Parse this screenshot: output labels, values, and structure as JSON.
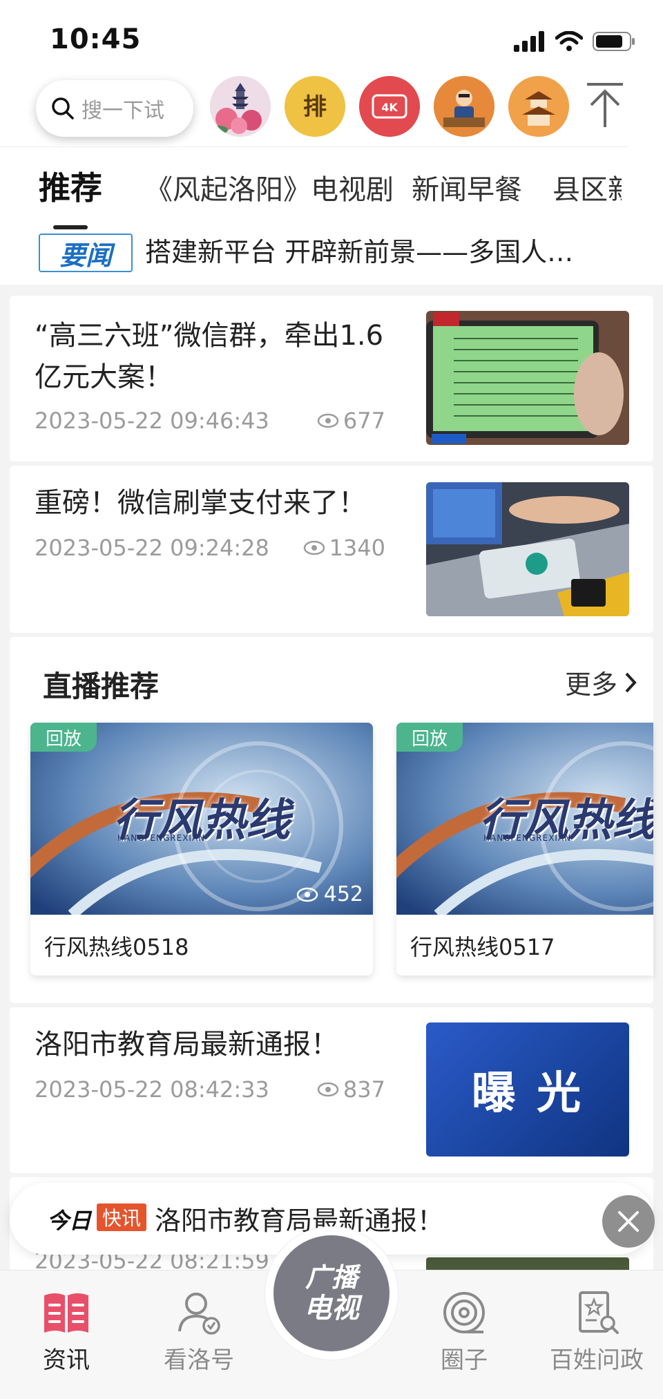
{
  "status": {
    "time": "10:45"
  },
  "search": {
    "placeholder": "搜一下试"
  },
  "shortcuts": [
    {
      "name": "pagoda-peony-icon"
    },
    {
      "name": "paihao-icon"
    },
    {
      "name": "4k-icon"
    },
    {
      "name": "teacher-icon"
    },
    {
      "name": "temple-icon"
    }
  ],
  "tabs": [
    {
      "label": "推荐",
      "active": true
    },
    {
      "label": "《风起洛阳》电视剧"
    },
    {
      "label": "新闻早餐"
    },
    {
      "label": "县区新"
    }
  ],
  "headline": {
    "badge": "要闻",
    "text": "搭建新平台 开辟新前景——多国人…"
  },
  "news": [
    {
      "title": "“高三六班”微信群，牵出1.6亿元大案！",
      "time": "2023-05-22 09:46:43",
      "views": "677"
    },
    {
      "title": "重磅！微信刷掌支付来了！",
      "time": "2023-05-22 09:24:28",
      "views": "1340"
    },
    {
      "title": "洛阳市教育局最新通报！",
      "time": "2023-05-22 08:42:33",
      "views": "837",
      "thumb_text": "曝 光"
    }
  ],
  "live": {
    "title": "直播推荐",
    "more": "更多",
    "items": [
      {
        "tag": "回放",
        "thumb_title": "行风热线",
        "thumb_sub": "HANGFENGREXIAN",
        "views": "452",
        "name": "行风热线0518"
      },
      {
        "tag": "回放",
        "thumb_title": "行风热线",
        "thumb_sub": "HANGFENGREXIAN",
        "name": "行风热线0517"
      }
    ]
  },
  "peek": {
    "time": "2023-05-22 08:21:59"
  },
  "flash": {
    "today": "今日",
    "kuai": "快讯",
    "text": "洛阳市教育局最新通报！"
  },
  "nav": {
    "items": [
      {
        "label": "资讯",
        "active": true
      },
      {
        "label": "看洛号"
      },
      {
        "label": "圈子"
      },
      {
        "label": "百姓问政"
      }
    ],
    "center": {
      "line1": "广播",
      "line2": "电视"
    }
  },
  "colors": {
    "accent": "#e8506a",
    "replay": "#4cb58e",
    "flash": "#e4552e",
    "headline_blue": "#1a6fc4"
  }
}
